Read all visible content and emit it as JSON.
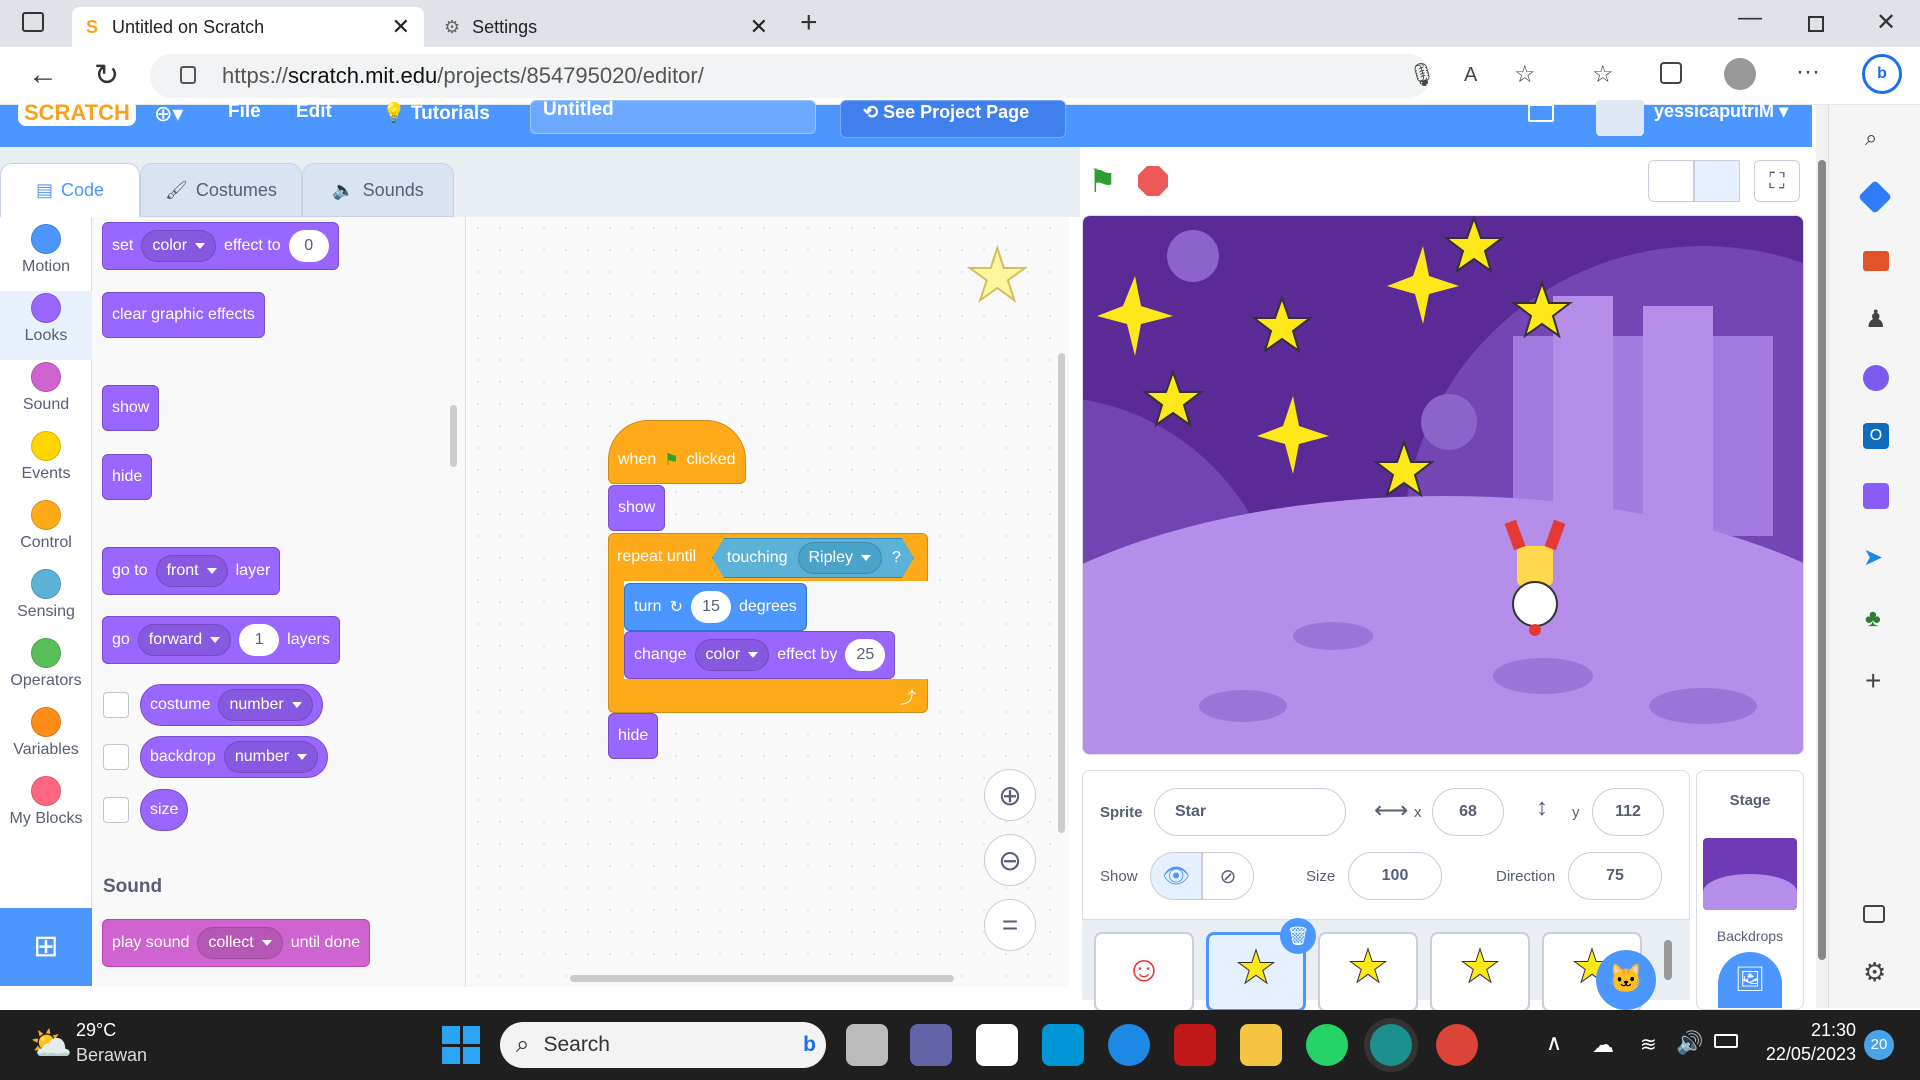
{
  "browser": {
    "tab1_title": "Untitled on Scratch",
    "tab2_title": "Settings",
    "url_prefix": "https://",
    "url_domain": "scratch.mit.edu",
    "url_path": "/projects/854795020/editor/"
  },
  "menubar": {
    "logo": "SCRATCH",
    "file": "File",
    "edit": "Edit",
    "tutorials": "Tutorials",
    "title": "Untitled",
    "see_project": "See Project Page",
    "username": "yessicaputriM"
  },
  "tabs": {
    "code": "Code",
    "costumes": "Costumes",
    "sounds": "Sounds"
  },
  "categories": [
    {
      "label": "Motion",
      "color": "#4c97ff"
    },
    {
      "label": "Looks",
      "color": "#9966ff"
    },
    {
      "label": "Sound",
      "color": "#cf63cf"
    },
    {
      "label": "Events",
      "color": "#ffd500"
    },
    {
      "label": "Control",
      "color": "#ffab19"
    },
    {
      "label": "Sensing",
      "color": "#5cb1d6"
    },
    {
      "label": "Operators",
      "color": "#59c059"
    },
    {
      "label": "Variables",
      "color": "#ff8c1a"
    },
    {
      "label": "My Blocks",
      "color": "#ff6680"
    }
  ],
  "palette": {
    "set_effect": {
      "set": "set",
      "effect": "color",
      "to": "effect to",
      "value": "0"
    },
    "clear": "clear graphic effects",
    "show": "show",
    "hide": "hide",
    "goto_layer": {
      "go_to": "go to",
      "front": "front",
      "layer": "layer"
    },
    "go_layers": {
      "go": "go",
      "forward": "forward",
      "value": "1",
      "layers": "layers"
    },
    "costume": {
      "label": "costume",
      "option": "number"
    },
    "backdrop": {
      "label": "backdrop",
      "option": "number"
    },
    "size": "size",
    "sound_heading": "Sound",
    "play_sound": {
      "play": "play sound",
      "option": "collect",
      "until": "until done"
    }
  },
  "script": {
    "when": "when",
    "clicked": "clicked",
    "show": "show",
    "repeat_until": "repeat until",
    "touching": "touching",
    "ripley": "Ripley",
    "q": "?",
    "turn": "turn",
    "turn_value": "15",
    "degrees": "degrees",
    "change": "change",
    "change_effect": "color",
    "effect_by": "effect by",
    "change_value": "25",
    "hide": "hide"
  },
  "sprite_info": {
    "sprite_label": "Sprite",
    "sprite_name": "Star",
    "x_label": "x",
    "x": "68",
    "y_label": "y",
    "y": "112",
    "show_label": "Show",
    "size_label": "Size",
    "size": "100",
    "direction_label": "Direction",
    "direction": "75"
  },
  "stage_panel": {
    "title": "Stage",
    "backdrops": "Backdrops"
  },
  "taskbar": {
    "temp": "29°C",
    "weather": "Berawan",
    "search": "Search",
    "time": "21:30",
    "date": "22/05/2023",
    "notif": "20"
  }
}
